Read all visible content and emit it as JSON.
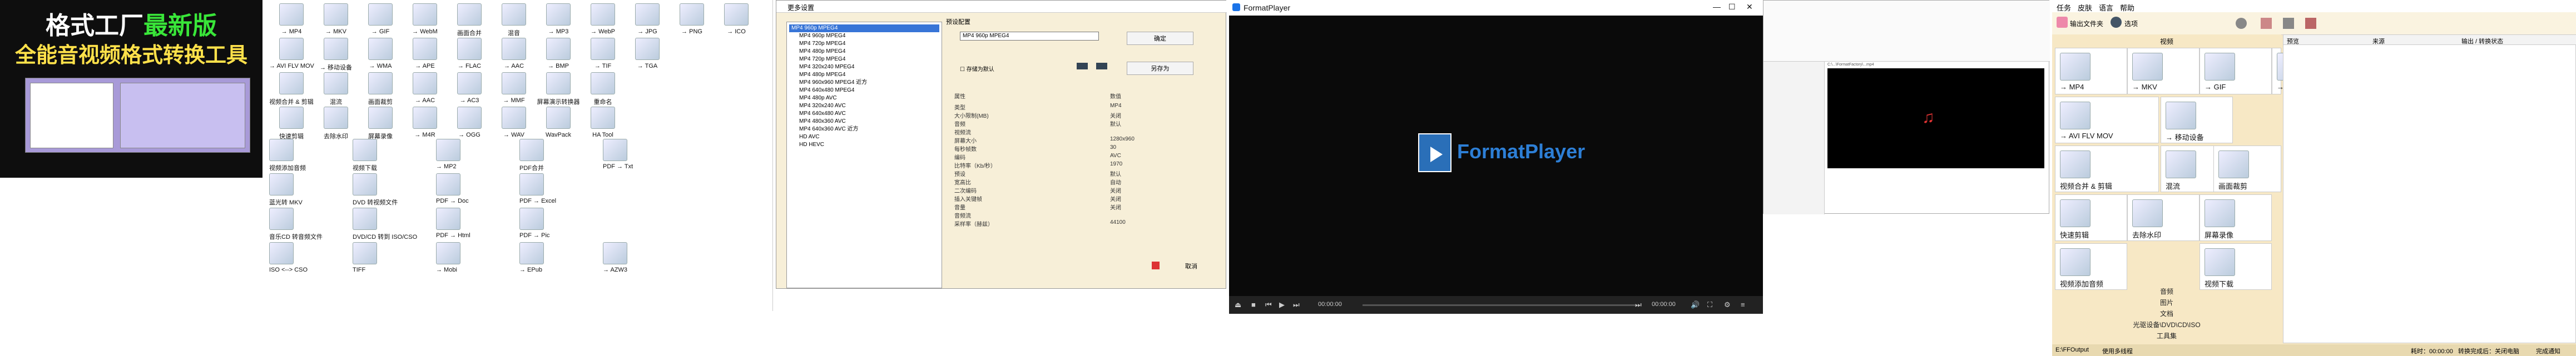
{
  "promo": {
    "title_part1": "格式工厂",
    "title_part2": "最新版",
    "subtitle": "全能音视频格式转换工具"
  },
  "grid1": {
    "row1": [
      "→ MP4",
      "→ MKV",
      "→ GIF",
      "→ WebM",
      "画面合并",
      "混音",
      "→ MP3",
      "→ WebP",
      "→ JPG",
      "→ PNG",
      "→ ICO"
    ],
    "row2": [
      "→ AVI FLV MOV",
      "→ 移动设备",
      "→ WMA",
      "→ APE",
      "→ FLAC",
      "→ AAC",
      "→ BMP",
      "→ TIF",
      "→ TGA"
    ],
    "row3": [
      "视频合并 & 剪辑",
      "混流",
      "画面裁剪",
      "→ AAC",
      "→ AC3",
      "→ MMF",
      "屏幕演示转换器",
      "重命名"
    ],
    "row4": [
      "快速剪辑",
      "去除水印",
      "屏幕录像",
      "→ M4R",
      "→ OGG",
      "→ WAV",
      "WavPack",
      "HA Tool"
    ],
    "row5": [
      "视频添加音频",
      "视频下载",
      "→ MP2",
      "PDF合并",
      "PDF → Txt"
    ],
    "row6": [
      "蓝光转 MKV",
      "DVD 转视频文件",
      "PDF → Doc",
      "PDF → Excel"
    ],
    "row7": [
      "音乐CD 转音频文件",
      "DVD/CD 转到 ISO/CSO",
      "PDF → Html",
      "PDF → Pic"
    ],
    "row8": [
      "ISO <--> CSO",
      "TIFF",
      "→ Mobi",
      "→ EPub",
      "→ AZW3"
    ]
  },
  "settings": {
    "title": "更多设置",
    "label_preset": "预设配置",
    "selected_preset": "MP4 960p MPEG4",
    "btn_ok": "确定",
    "btn_save": "另存为",
    "checkbox_default": "存储为默认",
    "tree": [
      "MP4 960p MPEG4",
      "MP4 960p MPEG4",
      "MP4 720p MPEG4",
      "MP4 480p MPEG4",
      "MP4 720p MPEG4",
      "MP4 320x240 MPEG4",
      "MP4 480p MPEG4",
      "MP4 960x960 MPEG4 近方",
      "MP4 640x480 MPEG4",
      "MP4 480p AVC",
      "MP4 320x240 AVC",
      "MP4 640x480 AVC",
      "MP4 480x360 AVC",
      "MP4 640x360 AVC 近方",
      "HD AVC",
      "HD HEVC"
    ],
    "props_header_left": "属性",
    "props_header_right": "数值",
    "props": [
      [
        "类型",
        "MP4"
      ],
      [
        "大小限制(MB)",
        "关闭"
      ],
      [
        "音频",
        "默认"
      ],
      [
        "视频流",
        ""
      ],
      [
        "屏幕大小",
        "1280x960"
      ],
      [
        "每秒帧数",
        "30"
      ],
      [
        "编码",
        "AVC"
      ],
      [
        "比特率（Kb/秒）",
        "1970"
      ],
      [
        "预设",
        "默认"
      ],
      [
        "宽高比",
        "自动"
      ],
      [
        "二次编码",
        "关闭"
      ],
      [
        "插入关键帧",
        "关闭"
      ],
      [
        "音量",
        "关闭"
      ],
      [
        "音频流",
        ""
      ],
      [
        "采样率（赫兹）",
        "44100"
      ]
    ],
    "btn_cancel": "取消"
  },
  "player": {
    "title": "FormatPlayer",
    "logo_text": "FormatPlayer",
    "time_left": "00:00:00",
    "time_right": "00:00:00"
  },
  "small_player": {
    "url": "C:\\...\\FormatFactory\\...mp4"
  },
  "ff": {
    "menu": [
      "任务",
      "皮肤",
      "语言",
      "帮助"
    ],
    "toolbar": [
      "输出文件夹",
      "选项"
    ],
    "side_header": "视频",
    "cells": [
      "→ MP4",
      "→ MKV",
      "→ GIF",
      "→ WebM",
      "→ AVI FLV MOV",
      "→ 移动设备",
      "视频合并 & 剪辑",
      "混流",
      "画面裁剪",
      "快速剪辑",
      "去除水印",
      "屏幕录像",
      "视频添加音频",
      "视频下载"
    ],
    "tabs": [
      "音频",
      "图片",
      "文档",
      "光驱设备\\DVD\\CD\\ISO",
      "工具集"
    ],
    "list_headers": [
      "预览",
      "来源",
      "输出 / 转换状态"
    ],
    "status": [
      "E:\\FFOutput",
      "使用多线程",
      "耗时：00:00:00",
      "转换完成后：关闭电脑",
      "完成通知"
    ]
  }
}
